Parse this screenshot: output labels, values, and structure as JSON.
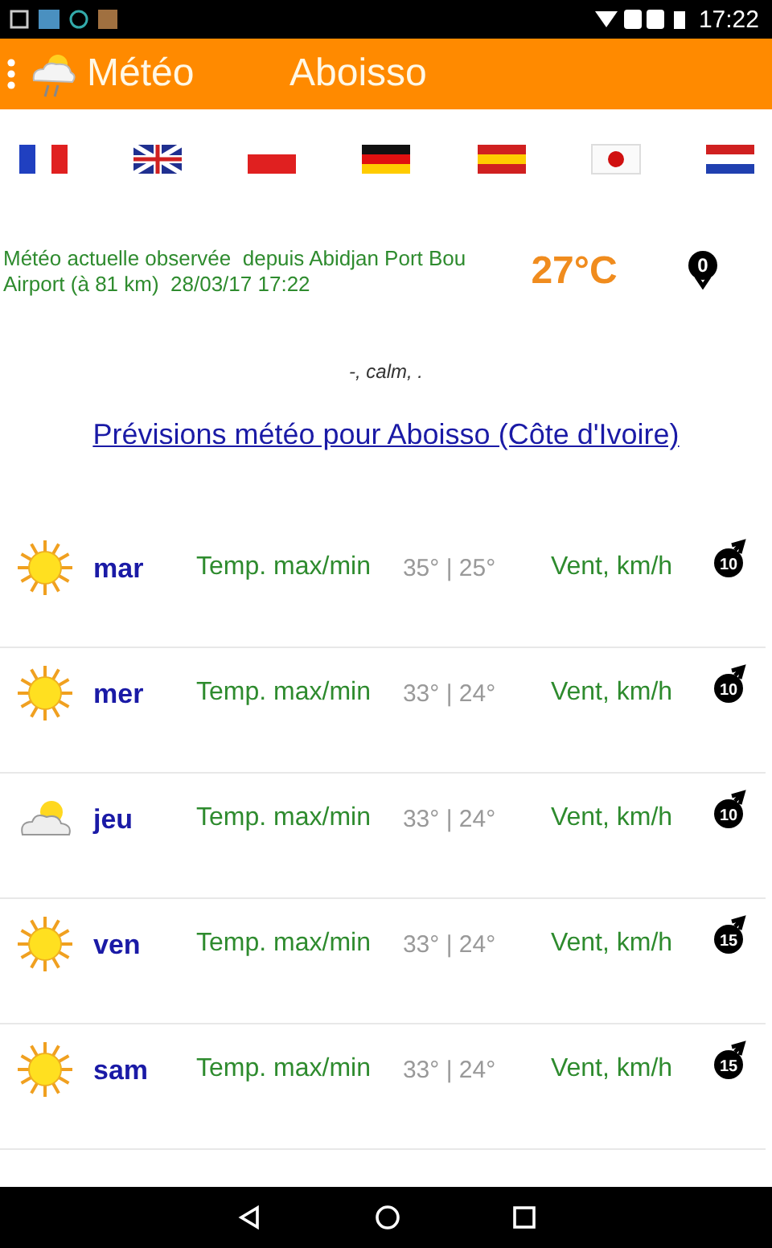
{
  "status_bar": {
    "time": "17:22"
  },
  "app_bar": {
    "app_name": "Météo",
    "city": "Aboisso"
  },
  "flags": [
    {
      "kind": "fr"
    },
    {
      "kind": "gb"
    },
    {
      "kind": "pl"
    },
    {
      "kind": "de"
    },
    {
      "kind": "es"
    },
    {
      "kind": "jp"
    },
    {
      "kind": "nl"
    }
  ],
  "current": {
    "observation": "Météo actuelle observée  depuis Abidjan Port Bou Airport (à 81 km)  28/03/17 17:22",
    "temperature": "27°C",
    "wind": {
      "speed": "0",
      "kind": "down"
    },
    "conditions": "-, calm, ."
  },
  "forecast_link": "Prévisions météo pour Aboisso (Côte d'Ivoire)",
  "forecast": [
    {
      "kind": "sun",
      "day": "mar",
      "temp_label": "Temp. max/min",
      "temps": "35° | 25°",
      "wind_label": "Vent, km/h",
      "wind": {
        "speed": "10",
        "kind": "ne"
      }
    },
    {
      "kind": "sun",
      "day": "mer",
      "temp_label": "Temp. max/min",
      "temps": "33° | 24°",
      "wind_label": "Vent, km/h",
      "wind": {
        "speed": "10",
        "kind": "ne"
      }
    },
    {
      "kind": "partly_cloudy",
      "day": "jeu",
      "temp_label": "Temp. max/min",
      "temps": "33° | 24°",
      "wind_label": "Vent, km/h",
      "wind": {
        "speed": "10",
        "kind": "ne"
      }
    },
    {
      "kind": "sun",
      "day": "ven",
      "temp_label": "Temp. max/min",
      "temps": "33° | 24°",
      "wind_label": "Vent, km/h",
      "wind": {
        "speed": "15",
        "kind": "ne"
      }
    },
    {
      "kind": "sun",
      "day": "sam",
      "temp_label": "Temp. max/min",
      "temps": "33° | 24°",
      "wind_label": "Vent, km/h",
      "wind": {
        "speed": "15",
        "kind": "ne"
      }
    }
  ]
}
